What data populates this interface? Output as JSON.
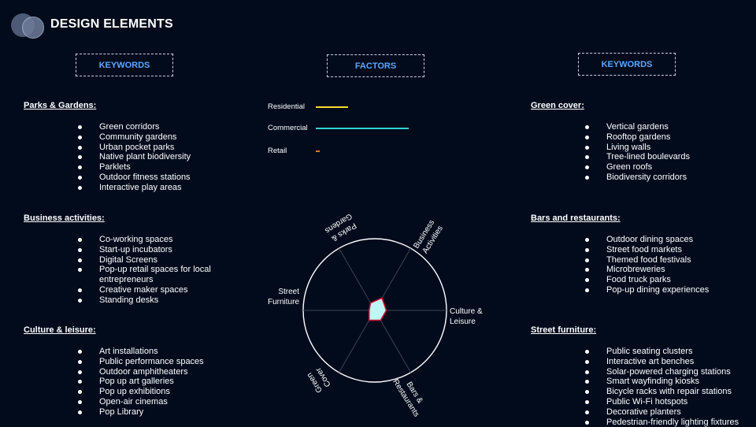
{
  "header": {
    "title": "DESIGN ELEMENTS"
  },
  "boxes": {
    "left": "KEYWORDS",
    "center": "FACTORS",
    "right": "KEYWORDS"
  },
  "left": [
    {
      "heading": "Parks & Gardens:",
      "items": [
        "Green corridors",
        "Community gardens",
        "Urban pocket parks",
        "Native plant biodiversity",
        "Parklets",
        "Outdoor fitness stations",
        "Interactive play areas"
      ]
    },
    {
      "heading": "Business activities:",
      "items": [
        "Co-working spaces",
        "Start-up incubators",
        "Digital Screens",
        "Pop-up retail spaces for local entrepreneurs",
        "Creative maker spaces",
        "Standing desks"
      ]
    },
    {
      "heading": "Culture & leisure:",
      "items": [
        "Art installations",
        "Public performance spaces",
        "Outdoor amphitheaters",
        "Pop up art galleries",
        "Pop up exhibitions",
        "Open-air cinemas",
        "Pop Library"
      ]
    }
  ],
  "right": [
    {
      "heading": "Green cover:",
      "items": [
        "Vertical gardens",
        "Rooftop gardens",
        "Living walls",
        "Tree-lined boulevards",
        "Green roofs",
        "Biodiversity corridors"
      ]
    },
    {
      "heading": "Bars and restaurants:",
      "items": [
        "Outdoor dining spaces",
        "Street food markets",
        "Themed food festivals",
        "Microbreweries",
        "Food truck parks",
        "Pop-up dining experiences"
      ]
    },
    {
      "heading": "Street furniture:",
      "items": [
        "Public seating clusters",
        "Interactive art benches",
        "Solar-powered charging stations",
        "Smart wayfinding kiosks",
        "Bicycle racks with repair stations",
        "Public Wi-Fi hotspots",
        "Decorative planters",
        "Pedestrian-friendly lighting fixtures"
      ]
    }
  ],
  "factors": {
    "legend": [
      {
        "label": "Residential",
        "color": "#f2dc2b",
        "level": 0.35
      },
      {
        "label": "Commercial",
        "color": "#2ed3d0",
        "level": 1.0
      },
      {
        "label": "Retail",
        "color": "#e0781a",
        "level": 0.04
      }
    ]
  },
  "chart_data": {
    "type": "radar",
    "axes": [
      "Parks & Gardens",
      "Business Activities",
      "Culture & Leisure",
      "Bars & Restaurants",
      "Green Cover",
      "Street Furniture"
    ],
    "axis_labels": [
      [
        "Parks &",
        "Gardens"
      ],
      [
        "Business",
        "Activities"
      ],
      [
        "Culture &",
        "Leisure"
      ],
      [
        "Bars &",
        "Restaurants"
      ],
      [
        "Green",
        "Cover"
      ],
      [
        "Street",
        "Furniture"
      ]
    ],
    "values": [
      0.12,
      0.2,
      0.16,
      0.16,
      0.16,
      0.08
    ],
    "range": [
      0,
      1
    ],
    "fill_color": "#bff6f6",
    "stroke_color": "#c8102e"
  }
}
